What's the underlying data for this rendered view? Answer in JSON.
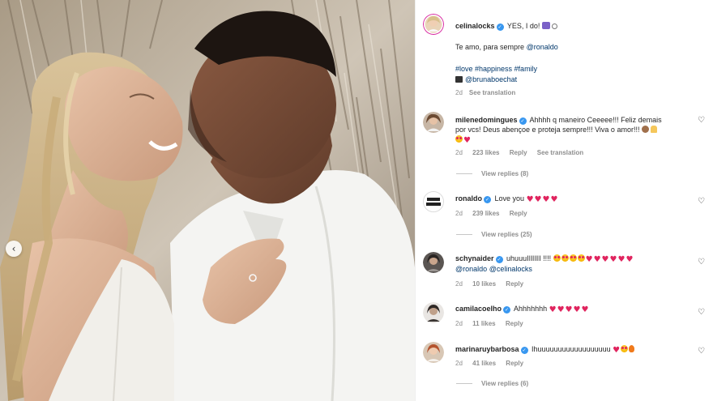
{
  "post": {
    "author": "celinalocks",
    "caption_title": "YES, I do!",
    "caption_emoji_icons": [
      "sos-box-icon",
      "ring-icon"
    ],
    "caption_line": "Te amo, para sempre",
    "caption_mention": "@ronaldo",
    "hashtags": "#love #happiness #family",
    "photo_credit_icon": "clapperboard-icon",
    "photo_credit": "@brunaboechat",
    "time": "2d",
    "see_translation": "See translation",
    "carousel_prev_icon": "chevron-left-icon"
  },
  "comments": [
    {
      "username": "milenedomingues",
      "verified": true,
      "text_line1": "Ahhhh q maneiro Ceeeee!!! Feliz demais",
      "text_line2": "por vcs! Deus abençoe e proteja sempre!!! Viva o amor!!!",
      "emoji_icons": [
        "heart-eyes-icon",
        "red-heart-icon"
      ],
      "time": "2d",
      "likes": "223 likes",
      "reply": "Reply",
      "see_translation": "See translation",
      "view_replies": "View replies (8)"
    },
    {
      "username": "ronaldo",
      "verified": true,
      "text": "Love you",
      "emoji_icons": [
        "red-heart-icon",
        "red-heart-icon",
        "red-heart-icon",
        "red-heart-icon"
      ],
      "time": "2d",
      "likes": "239 likes",
      "reply": "Reply",
      "view_replies": "View replies (25)",
      "avatar_text": "NO TO RACISM"
    },
    {
      "username": "schynaider",
      "verified": true,
      "text": "uhuuuIIIIIII !!!!",
      "mention1": "@ronaldo",
      "mention2": "@celinalocks",
      "time": "2d",
      "likes": "10 likes",
      "reply": "Reply"
    },
    {
      "username": "camilacoelho",
      "verified": true,
      "text": "Ahhhhhhh",
      "time": "2d",
      "likes": "11 likes",
      "reply": "Reply"
    },
    {
      "username": "marinaruybarbosa",
      "verified": true,
      "text": "Ihuuuuuuuuuuuuuuuuuu",
      "time": "2d",
      "likes": "41 likes",
      "reply": "Reply",
      "view_replies": "View replies (6)"
    }
  ],
  "icons": {
    "verified": "verified-badge-icon",
    "like": "heart-outline-icon"
  },
  "colors": {
    "link": "#00376b",
    "verified": "#3897f0",
    "muted": "#8e8e8e",
    "heart": "#e0245e"
  }
}
